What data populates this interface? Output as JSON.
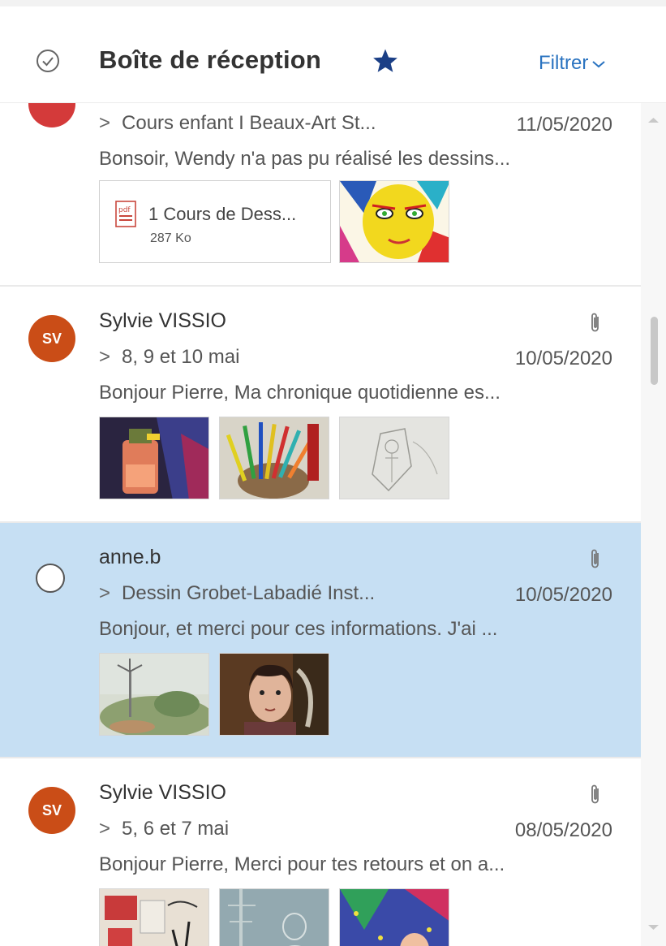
{
  "header": {
    "title": "Boîte de réception",
    "filter_label": "Filtrer"
  },
  "messages": [
    {
      "sender": "",
      "subject": "Cours enfant I Beaux-Art St...",
      "date": "11/05/2020",
      "preview": "Bonsoir, Wendy n'a pas pu réalisé les dessins...",
      "attachment": {
        "name": "1 Cours de Dess...",
        "size": "287 Ko"
      },
      "avatar_color": "#d43a3a"
    },
    {
      "sender": "Sylvie VISSIO",
      "initials": "SV",
      "subject": "8, 9 et 10 mai",
      "date": "10/05/2020",
      "preview": "Bonjour Pierre, Ma chronique quotidienne es...",
      "avatar_color": "#ca4d17"
    },
    {
      "sender": "anne.b",
      "subject": "Dessin Grobet-Labadié Inst...",
      "date": "10/05/2020",
      "preview": "Bonjour, et merci pour ces informations. J'ai ...",
      "selected": true
    },
    {
      "sender": "Sylvie VISSIO",
      "initials": "SV",
      "subject": "5, 6 et 7 mai",
      "date": "08/05/2020",
      "preview": "Bonjour Pierre, Merci pour tes retours et on a...",
      "avatar_color": "#ca4d17"
    }
  ],
  "colors": {
    "accent": "#2a73c0",
    "star": "#1b3f86",
    "selected_row": "#c6dff3"
  }
}
